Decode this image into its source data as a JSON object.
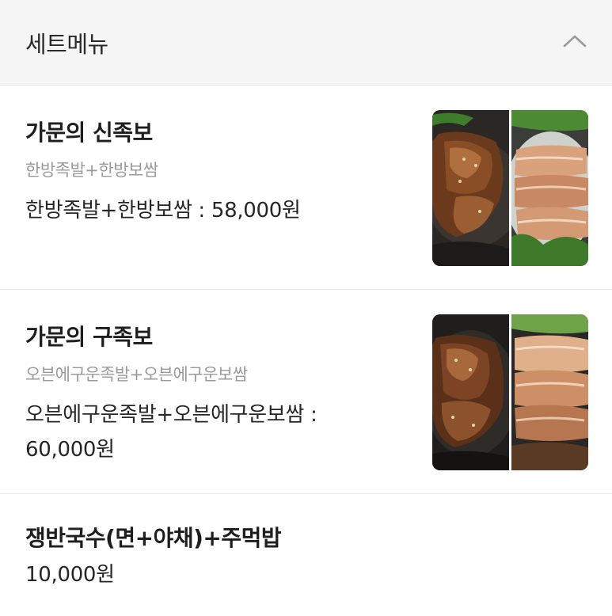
{
  "section": {
    "title": "세트메뉴",
    "collapse_icon": "chevron-up-icon"
  },
  "items": [
    {
      "name": "가문의 신족보",
      "description": "한방족발+한방보쌈",
      "price": "한방족발+한방보쌈 : 58,000원",
      "image": "jokbal-bossam-photo"
    },
    {
      "name": "가문의 구족보",
      "description": "오븐에구운족발+오븐에구운보쌈",
      "price": "오븐에구운족발+오븐에구운보쌈 : 60,000원",
      "image": "jokbal-bossam-photo"
    },
    {
      "name": "쟁반국수(면+야채)+주먹밥",
      "price": "10,000원"
    }
  ],
  "colors": {
    "header_bg": "#f5f5f5",
    "desc_text": "#9a9a9a",
    "title_text": "#1e1e1e"
  }
}
